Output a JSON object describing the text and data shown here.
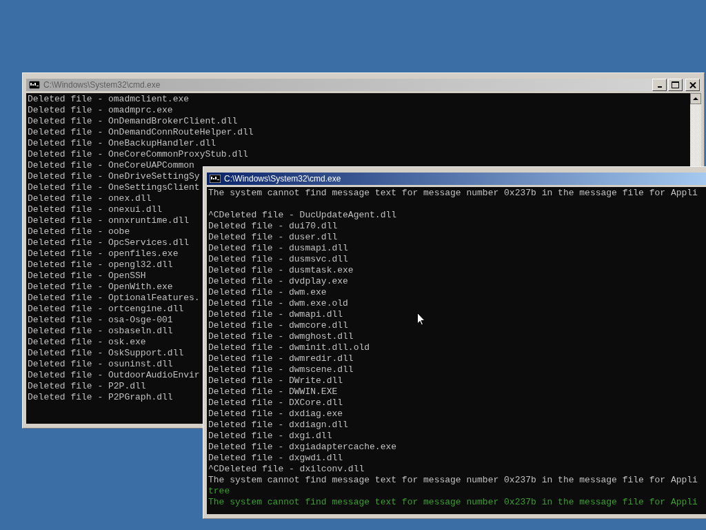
{
  "windows": [
    {
      "title": "C:\\Windows\\System32\\cmd.exe",
      "active": false,
      "controls": true,
      "scrollbar": true,
      "blocks": [
        {
          "lines": [
            {
              "text": "Deleted file - omadmclient.exe",
              "color": "#c0c0c0"
            },
            {
              "text": "Deleted file - omadmprc.exe",
              "color": "#c0c0c0"
            },
            {
              "text": "Deleted file - OnDemandBrokerClient.dll",
              "color": "#c0c0c0"
            },
            {
              "text": "Deleted file - OnDemandConnRouteHelper.dll",
              "color": "#c0c0c0"
            },
            {
              "text": "Deleted file - OneBackupHandler.dll",
              "color": "#c0c0c0"
            },
            {
              "text": "Deleted file - OneCoreCommonProxyStub.dll",
              "color": "#c0c0c0"
            },
            {
              "text": "Deleted file - OneCoreUAPCommon",
              "color": "#c0c0c0"
            },
            {
              "text": "Deleted file - OneDriveSettingSy",
              "color": "#c0c0c0"
            },
            {
              "text": "Deleted file - OneSettingsClient",
              "color": "#c0c0c0"
            },
            {
              "text": "Deleted file - onex.dll",
              "color": "#c0c0c0"
            },
            {
              "text": "Deleted file - onexui.dll",
              "color": "#c0c0c0"
            },
            {
              "text": "Deleted file - onnxruntime.dll",
              "color": "#c0c0c0"
            },
            {
              "text": "Deleted file - oobe",
              "color": "#c0c0c0"
            },
            {
              "text": "Deleted file - OpcServices.dll",
              "color": "#c0c0c0"
            },
            {
              "text": "Deleted file - openfiles.exe",
              "color": "#c0c0c0"
            },
            {
              "text": "Deleted file - opengl32.dll",
              "color": "#c0c0c0"
            },
            {
              "text": "Deleted file - OpenSSH",
              "color": "#c0c0c0"
            },
            {
              "text": "Deleted file - OpenWith.exe",
              "color": "#c0c0c0"
            },
            {
              "text": "Deleted file - OptionalFeatures.",
              "color": "#c0c0c0"
            },
            {
              "text": "Deleted file - ortcengine.dll",
              "color": "#c0c0c0"
            },
            {
              "text": "Deleted file - osa-Osge-001",
              "color": "#c0c0c0"
            },
            {
              "text": "Deleted file - osbaseln.dll",
              "color": "#c0c0c0"
            },
            {
              "text": "Deleted file - osk.exe",
              "color": "#c0c0c0"
            },
            {
              "text": "Deleted file - OskSupport.dll",
              "color": "#c0c0c0"
            },
            {
              "text": "Deleted file - osuninst.dll",
              "color": "#c0c0c0"
            },
            {
              "text": "Deleted file - OutdoorAudioEnvir",
              "color": "#c0c0c0"
            },
            {
              "text": "Deleted file - P2P.dll",
              "color": "#c0c0c0"
            },
            {
              "text": "Deleted file - P2PGraph.dll",
              "color": "#c0c0c0"
            }
          ]
        }
      ]
    },
    {
      "title": "C:\\Windows\\System32\\cmd.exe",
      "active": true,
      "controls": false,
      "scrollbar": false,
      "blocks": [
        {
          "lines": [
            {
              "text": "The system cannot find message text for message number 0x237b in the message file for Appli",
              "color": "#c0c0c0"
            }
          ]
        },
        {
          "lines": [
            {
              "text": "^CDeleted file - DucUpdateAgent.dll",
              "color": "#c0c0c0"
            },
            {
              "text": "Deleted file - dui70.dll",
              "color": "#c0c0c0"
            },
            {
              "text": "Deleted file - duser.dll",
              "color": "#c0c0c0"
            },
            {
              "text": "Deleted file - dusmapi.dll",
              "color": "#c0c0c0"
            },
            {
              "text": "Deleted file - dusmsvc.dll",
              "color": "#c0c0c0"
            },
            {
              "text": "Deleted file - dusmtask.exe",
              "color": "#c0c0c0"
            },
            {
              "text": "Deleted file - dvdplay.exe",
              "color": "#c0c0c0"
            },
            {
              "text": "Deleted file - dwm.exe",
              "color": "#c0c0c0"
            },
            {
              "text": "Deleted file - dwm.exe.old",
              "color": "#c0c0c0"
            },
            {
              "text": "Deleted file - dwmapi.dll",
              "color": "#c0c0c0"
            },
            {
              "text": "Deleted file - dwmcore.dll",
              "color": "#c0c0c0"
            },
            {
              "text": "Deleted file - dwmghost.dll",
              "color": "#c0c0c0"
            },
            {
              "text": "Deleted file - dwminit.dll.old",
              "color": "#c0c0c0"
            },
            {
              "text": "Deleted file - dwmredir.dll",
              "color": "#c0c0c0"
            },
            {
              "text": "Deleted file - dwmscene.dll",
              "color": "#c0c0c0"
            },
            {
              "text": "Deleted file - DWrite.dll",
              "color": "#c0c0c0"
            },
            {
              "text": "Deleted file - DWWIN.EXE",
              "color": "#c0c0c0"
            },
            {
              "text": "Deleted file - DXCore.dll",
              "color": "#c0c0c0"
            },
            {
              "text": "Deleted file - dxdiag.exe",
              "color": "#c0c0c0"
            },
            {
              "text": "Deleted file - dxdiagn.dll",
              "color": "#c0c0c0"
            },
            {
              "text": "Deleted file - dxgi.dll",
              "color": "#c0c0c0"
            },
            {
              "text": "Deleted file - dxgiadaptercache.exe",
              "color": "#c0c0c0"
            },
            {
              "text": "Deleted file - dxgwdi.dll",
              "color": "#c0c0c0"
            },
            {
              "text": "^CDeleted file - dxilconv.dll",
              "color": "#c0c0c0"
            },
            {
              "text": "The system cannot find message text for message number 0x237b in the message file for Appli",
              "color": "#c0c0c0"
            },
            {
              "text": "tree",
              "color": "#3a9e2e"
            },
            {
              "text": "The system cannot find message text for message number 0x237b in the message file for Appli",
              "color": "#3a9e2e"
            }
          ]
        }
      ]
    }
  ]
}
